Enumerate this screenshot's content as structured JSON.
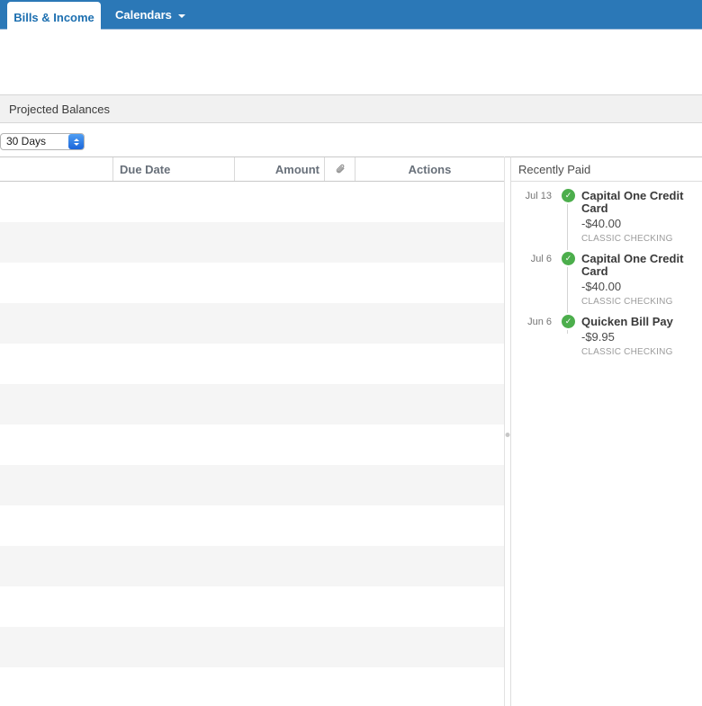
{
  "tabs": {
    "bills_income": "Bills & Income",
    "calendars": "Calendars"
  },
  "projected_balances": {
    "title": "Projected Balances"
  },
  "range_select": {
    "value": "30 Days"
  },
  "bills_table": {
    "headers": {
      "name": "",
      "due_date": "Due Date",
      "amount": "Amount",
      "attachment_icon": "paperclip-icon",
      "actions": "Actions"
    },
    "visible_empty_rows": 13
  },
  "recently_paid": {
    "title": "Recently Paid",
    "entries": [
      {
        "date": "Jul 13",
        "payee": "Capital One Credit Card",
        "amount": "-$40.00",
        "account": "CLASSIC CHECKING"
      },
      {
        "date": "Jul 6",
        "payee": "Capital One Credit Card",
        "amount": "-$40.00",
        "account": "CLASSIC CHECKING"
      },
      {
        "date": "Jun 6",
        "payee": "Quicken Bill Pay",
        "amount": "-$9.95",
        "account": "CLASSIC CHECKING"
      }
    ],
    "check_glyph": "✓"
  },
  "colors": {
    "accent_blue": "#2b78b7",
    "tab_text_blue": "#1c6fb0",
    "success_green": "#4cae4c",
    "row_stripe_gray": "#f5f5f5"
  }
}
